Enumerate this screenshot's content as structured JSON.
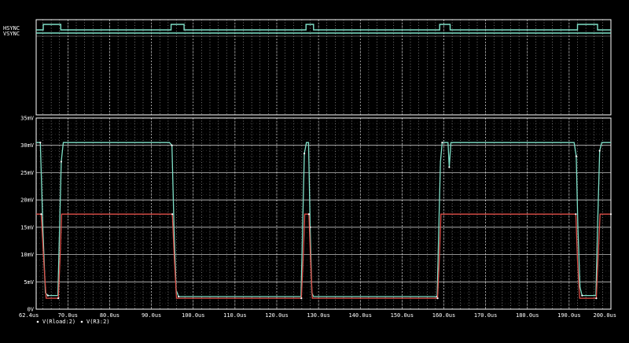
{
  "colors": {
    "background": "#000000",
    "grid": "#ffffff",
    "trace_primary": "#7fe0c8",
    "trace_secondary": "#e0504a"
  },
  "digital": {
    "signals": [
      {
        "name": "HSYNC"
      },
      {
        "name": "VSYNC"
      }
    ]
  },
  "legend": {
    "items": [
      {
        "label": "V(Rload:2)"
      },
      {
        "label": "V(R3:2)"
      }
    ]
  },
  "chart_data": {
    "type": "line",
    "title": "",
    "xlabel": "",
    "ylabel": "",
    "xlim": [
      62.4,
      200
    ],
    "ylim": [
      0,
      35
    ],
    "x_unit": "us",
    "y_unit": "mV",
    "grid": true,
    "xticks": [
      62.4,
      70,
      80,
      90,
      100,
      110,
      120,
      130,
      140,
      150,
      160,
      170,
      180,
      190,
      200
    ],
    "xtick_labels": [
      "62.4us",
      "70.0us",
      "80.0us",
      "90.0us",
      "100.0us",
      "110.0us",
      "120.0us",
      "130.0us",
      "140.0us",
      "150.0us",
      "160.0us",
      "170.0us",
      "180.0us",
      "190.0us",
      "200.0us"
    ],
    "yticks": [
      0,
      5,
      10,
      15,
      20,
      25,
      30,
      35
    ],
    "ytick_labels": [
      "0V",
      "5mV",
      "10mV",
      "15mV",
      "20mV",
      "25mV",
      "30mV",
      "35mV"
    ],
    "series": [
      {
        "name": "V(Rload:2)",
        "points": [
          [
            62.4,
            30.5
          ],
          [
            63.4,
            30.5
          ],
          [
            64.0,
            15.0
          ],
          [
            64.6,
            3.0
          ],
          [
            65.2,
            2.5
          ],
          [
            67.6,
            2.5
          ],
          [
            68.0,
            15.0
          ],
          [
            68.4,
            27.0
          ],
          [
            68.9,
            30.5
          ],
          [
            94.3,
            30.5
          ],
          [
            94.9,
            30.0
          ],
          [
            95.4,
            15.0
          ],
          [
            95.9,
            3.5
          ],
          [
            96.5,
            2.3
          ],
          [
            125.8,
            2.3
          ],
          [
            126.2,
            15.0
          ],
          [
            126.6,
            28.5
          ],
          [
            127.1,
            30.5
          ],
          [
            127.6,
            30.5
          ],
          [
            128.0,
            15.0
          ],
          [
            128.4,
            3.0
          ],
          [
            128.8,
            2.3
          ],
          [
            158.4,
            2.3
          ],
          [
            158.8,
            15.0
          ],
          [
            159.2,
            27.0
          ],
          [
            159.6,
            30.5
          ],
          [
            160.0,
            30.5
          ],
          [
            161.0,
            30.5
          ],
          [
            161.3,
            26.0
          ],
          [
            161.7,
            30.5
          ],
          [
            191.2,
            30.5
          ],
          [
            191.7,
            28.0
          ],
          [
            192.1,
            15.0
          ],
          [
            192.6,
            4.0
          ],
          [
            193.1,
            2.5
          ],
          [
            196.4,
            2.5
          ],
          [
            196.8,
            15.0
          ],
          [
            197.3,
            29.0
          ],
          [
            197.8,
            30.5
          ],
          [
            200.0,
            30.5
          ]
        ]
      },
      {
        "name": "V(R3:2)",
        "points": [
          [
            62.4,
            17.4
          ],
          [
            63.6,
            17.4
          ],
          [
            64.2,
            9.0
          ],
          [
            64.8,
            2.0
          ],
          [
            67.7,
            2.0
          ],
          [
            68.1,
            9.0
          ],
          [
            68.5,
            17.4
          ],
          [
            95.0,
            17.4
          ],
          [
            95.5,
            9.0
          ],
          [
            96.0,
            2.0
          ],
          [
            125.9,
            2.0
          ],
          [
            126.3,
            9.0
          ],
          [
            126.7,
            17.4
          ],
          [
            127.7,
            17.4
          ],
          [
            128.1,
            9.0
          ],
          [
            128.5,
            2.0
          ],
          [
            158.5,
            2.0
          ],
          [
            158.9,
            9.0
          ],
          [
            159.3,
            17.4
          ],
          [
            191.6,
            17.4
          ],
          [
            192.0,
            9.0
          ],
          [
            192.5,
            2.0
          ],
          [
            196.5,
            2.0
          ],
          [
            196.9,
            9.0
          ],
          [
            197.4,
            17.4
          ],
          [
            200.0,
            17.4
          ]
        ]
      }
    ]
  }
}
